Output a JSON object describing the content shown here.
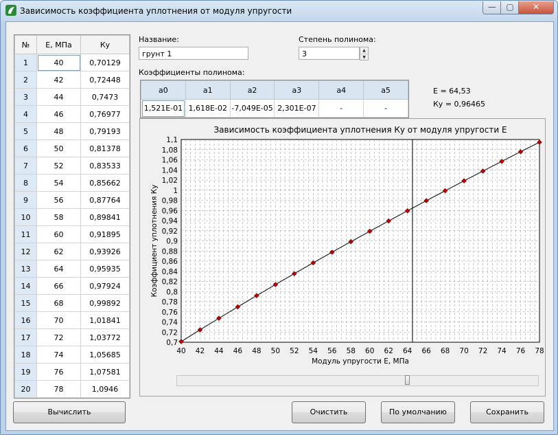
{
  "window": {
    "title": "Зависимость коэффициента уплотнения от модуля упругости",
    "close_glyph": "✕",
    "min_glyph": "—",
    "max_glyph": "▢"
  },
  "table": {
    "headers": [
      "№",
      "E, МПа",
      "Ку"
    ],
    "rows": [
      [
        "1",
        "40",
        "0,70129"
      ],
      [
        "2",
        "42",
        "0,72448"
      ],
      [
        "3",
        "44",
        "0,7473"
      ],
      [
        "4",
        "46",
        "0,76977"
      ],
      [
        "5",
        "48",
        "0,79193"
      ],
      [
        "6",
        "50",
        "0,81378"
      ],
      [
        "7",
        "52",
        "0,83533"
      ],
      [
        "8",
        "54",
        "0,85662"
      ],
      [
        "9",
        "56",
        "0,87764"
      ],
      [
        "10",
        "58",
        "0,89841"
      ],
      [
        "11",
        "60",
        "0,91895"
      ],
      [
        "12",
        "62",
        "0,93926"
      ],
      [
        "13",
        "64",
        "0,95935"
      ],
      [
        "14",
        "66",
        "0,97924"
      ],
      [
        "15",
        "68",
        "0,99892"
      ],
      [
        "16",
        "70",
        "1,01841"
      ],
      [
        "17",
        "72",
        "1,03772"
      ],
      [
        "18",
        "74",
        "1,05685"
      ],
      [
        "19",
        "76",
        "1,07581"
      ],
      [
        "20",
        "78",
        "1,0946"
      ]
    ]
  },
  "form": {
    "name_label": "Название:",
    "name_value": "грунт 1",
    "degree_label": "Степень полинома:",
    "degree_value": "3",
    "coef_label": "Коэффициенты полинома:",
    "coef_headers": [
      "a0",
      "a1",
      "a2",
      "a3",
      "a4",
      "a5"
    ],
    "coef_values": [
      "1,521E-01",
      "1,618E-02",
      "-7,049E-05",
      "2,301E-07",
      "-",
      "-"
    ]
  },
  "result": {
    "e_line": "E   = 64,53",
    "ky_line": "Ку = 0,96465"
  },
  "buttons": {
    "calc": "Вычислить",
    "clear": "Очистить",
    "default": "По умолчанию",
    "save": "Сохранить"
  },
  "chart_data": {
    "type": "line",
    "title": "Зависимость коэффициента уплотнения Ку от модуля упругости Е",
    "xlabel": "Модуль упругости Е, МПа",
    "ylabel": "Коэффициент уплотнения Ку",
    "xlim": [
      40,
      78
    ],
    "ylim": [
      0.7,
      1.1
    ],
    "grid": true,
    "x": [
      40,
      42,
      44,
      46,
      48,
      50,
      52,
      54,
      56,
      58,
      60,
      62,
      64,
      66,
      68,
      70,
      72,
      74,
      76,
      78
    ],
    "y": [
      0.70129,
      0.72448,
      0.7473,
      0.76977,
      0.79193,
      0.81378,
      0.83533,
      0.85662,
      0.87764,
      0.89841,
      0.91895,
      0.93926,
      0.95935,
      0.97924,
      0.99892,
      1.01841,
      1.03772,
      1.05685,
      1.07581,
      1.0946
    ],
    "xticks": [
      "40",
      "42",
      "44",
      "46",
      "48",
      "50",
      "52",
      "54",
      "56",
      "58",
      "60",
      "62",
      "64",
      "66",
      "68",
      "70",
      "72",
      "74",
      "76",
      "78"
    ],
    "yticks": [
      "0,7",
      "0,72",
      "0,74",
      "0,76",
      "0,78",
      "0,8",
      "0,82",
      "0,84",
      "0,86",
      "0,88",
      "0,9",
      "0,92",
      "0,94",
      "0,96",
      "0,98",
      "1",
      "1,02",
      "1,04",
      "1,06",
      "1,08",
      "1,1"
    ],
    "marker_line_x": 64.53,
    "line_color": "#000000",
    "marker_color": "#c00000",
    "slider_value": 0.64
  }
}
